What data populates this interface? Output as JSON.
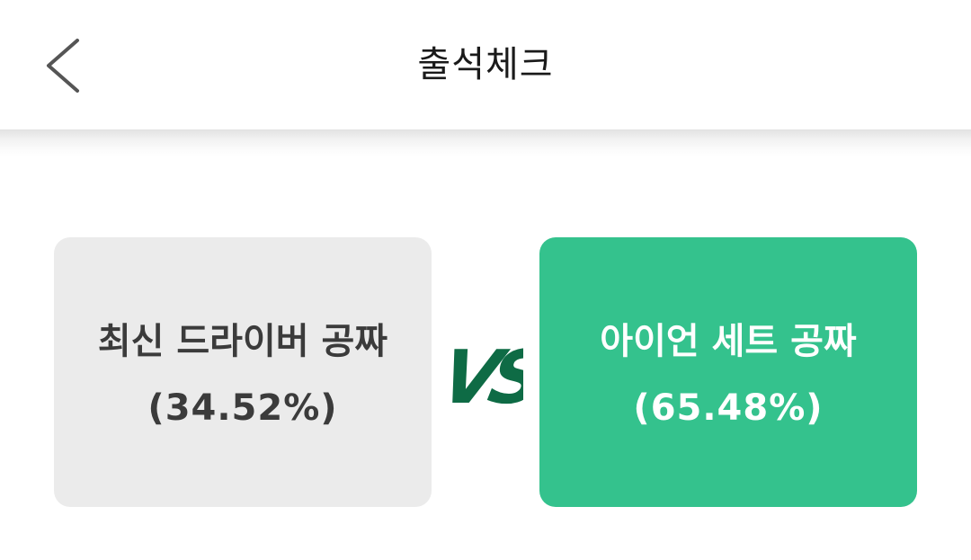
{
  "header": {
    "title": "출석체크",
    "back_icon": "chevron-left-icon"
  },
  "vs": {
    "label": "VS",
    "color": "#0e6b45"
  },
  "options": [
    {
      "label": "최신 드라이버 공짜",
      "percent": "(34.52%)",
      "share": 34.52,
      "background": "#ebebeb",
      "text_color": "#3b3b3b"
    },
    {
      "label": "아이언 세트 공짜",
      "percent": "(65.48%)",
      "share": 65.48,
      "background": "#34c28d",
      "text_color": "#ffffff"
    }
  ]
}
